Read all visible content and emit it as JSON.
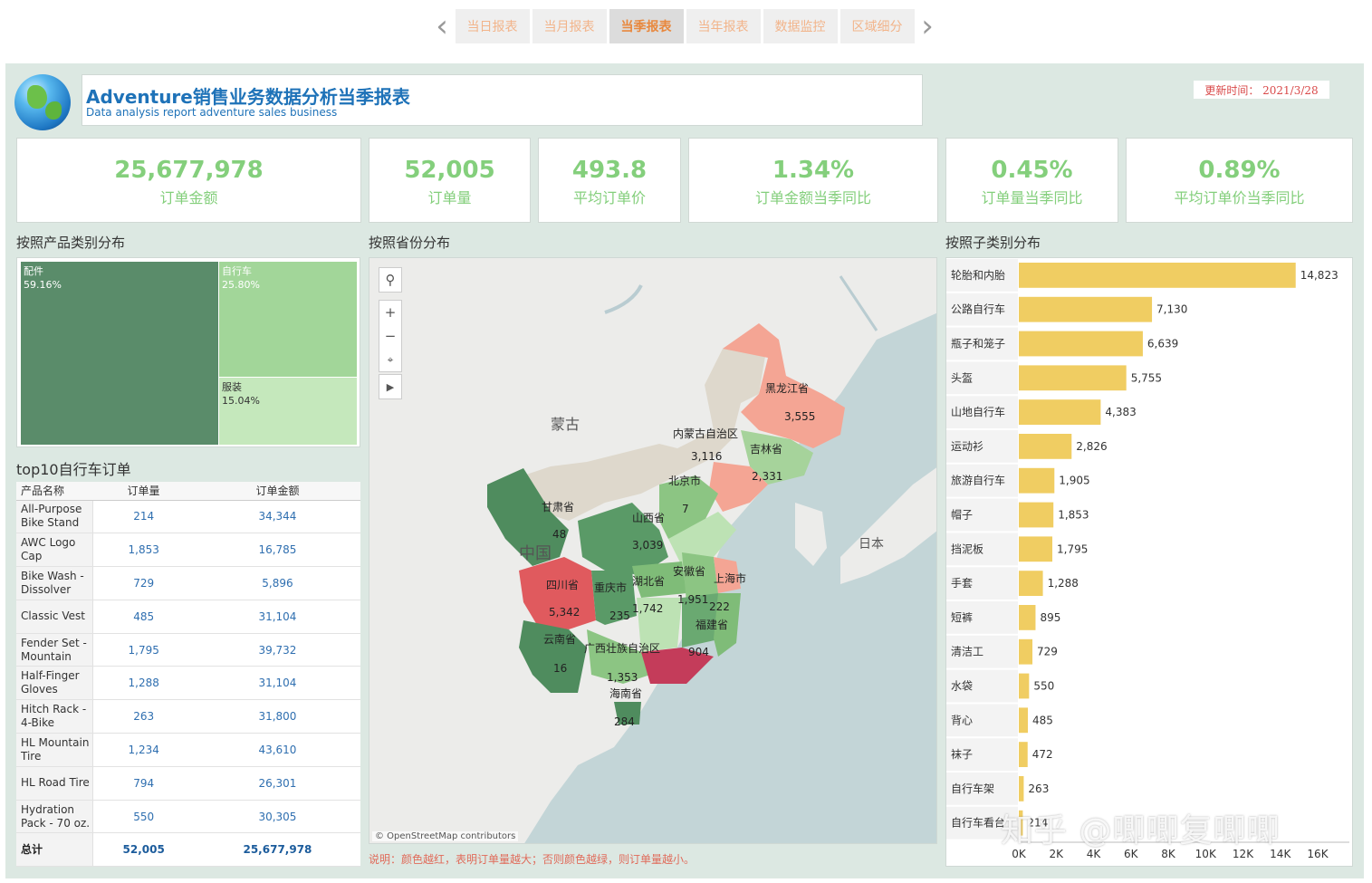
{
  "tabs": [
    {
      "label": "当日报表",
      "active": false
    },
    {
      "label": "当月报表",
      "active": false
    },
    {
      "label": "当季报表",
      "active": true
    },
    {
      "label": "当年报表",
      "active": false
    },
    {
      "label": "数据监控",
      "active": false
    },
    {
      "label": "区域细分",
      "active": false
    }
  ],
  "header": {
    "title": "Adventure销售业务数据分析当季报表",
    "subtitle": "Data analysis report adventure sales business",
    "update_time": "更新时间： 2021/3/28"
  },
  "kpis": [
    {
      "value": "25,677,978",
      "label": "订单金额"
    },
    {
      "value": "52,005",
      "label": "订单量"
    },
    {
      "value": "493.8",
      "label": "平均订单价"
    },
    {
      "value": "1.34%",
      "label": "订单金额当季同比"
    },
    {
      "value": "0.45%",
      "label": "订单量当季同比"
    },
    {
      "value": "0.89%",
      "label": "平均订单价当季同比"
    }
  ],
  "sections": {
    "category": "按照产品类别分布",
    "province": "按照省份分布",
    "subcategory": "按照子类别分布",
    "top10": "top10自行车订单"
  },
  "treemap": [
    {
      "name": "配件",
      "pct": "59.16%",
      "value": 59.16
    },
    {
      "name": "自行车",
      "pct": "25.80%",
      "value": 25.8
    },
    {
      "name": "服装",
      "pct": "15.04%",
      "value": 15.04
    }
  ],
  "table": {
    "headers": [
      "产品名称",
      "订单量",
      "订单金额"
    ],
    "rows": [
      [
        "All-Purpose Bike Stand",
        "214",
        "34,344"
      ],
      [
        "AWC Logo Cap",
        "1,853",
        "16,785"
      ],
      [
        "Bike Wash - Dissolver",
        "729",
        "5,896"
      ],
      [
        "Classic Vest",
        "485",
        "31,104"
      ],
      [
        "Fender Set - Mountain",
        "1,795",
        "39,732"
      ],
      [
        "Half-Finger Gloves",
        "1,288",
        "31,104"
      ],
      [
        "Hitch Rack - 4-Bike",
        "263",
        "31,800"
      ],
      [
        "HL Mountain Tire",
        "1,234",
        "43,610"
      ],
      [
        "HL Road Tire",
        "794",
        "26,301"
      ],
      [
        "Hydration Pack - 70 oz.",
        "550",
        "30,305"
      ]
    ],
    "total": [
      "总计",
      "52,005",
      "25,677,978"
    ]
  },
  "map": {
    "country_labels": [
      "蒙古",
      "中国",
      "日本"
    ],
    "provinces": [
      {
        "name": "黑龙江省",
        "value": "3,555"
      },
      {
        "name": "内蒙古自治区",
        "value": "3,116"
      },
      {
        "name": "吉林省",
        "value": "2,331"
      },
      {
        "name": "北京市",
        "value": "7"
      },
      {
        "name": "甘肃省",
        "value": "48"
      },
      {
        "name": "山西省",
        "value": "3,039"
      },
      {
        "name": "四川省",
        "value": "5,342"
      },
      {
        "name": "重庆市",
        "value": "235"
      },
      {
        "name": "湖北省",
        "value": "1,742"
      },
      {
        "name": "安徽省",
        "value": "1,951"
      },
      {
        "name": "上海市",
        "value": "222"
      },
      {
        "name": "云南省",
        "value": "16"
      },
      {
        "name": "广西壮族自治区",
        "value": "1,353"
      },
      {
        "name": "福建省",
        "value": "904"
      },
      {
        "name": "海南省",
        "value": "284"
      }
    ],
    "attribution": "© OpenStreetMap contributors",
    "controls": [
      "search-icon",
      "plus-icon",
      "minus-icon",
      "lasso-icon",
      "play-icon"
    ]
  },
  "note": "说明：颜色越红，表明订单量越大；否则颜色越绿，则订单量越小。",
  "chart_data": {
    "type": "bar",
    "orientation": "horizontal",
    "categories": [
      "轮胎和内胎",
      "公路自行车",
      "瓶子和笼子",
      "头盔",
      "山地自行车",
      "运动衫",
      "旅游自行车",
      "帽子",
      "挡泥板",
      "手套",
      "短裤",
      "清洁工",
      "水袋",
      "背心",
      "袜子",
      "自行车架",
      "自行车看台"
    ],
    "values": [
      14823,
      7130,
      6639,
      5755,
      4383,
      2826,
      1905,
      1853,
      1795,
      1288,
      895,
      729,
      550,
      485,
      472,
      263,
      214
    ],
    "value_labels": [
      "14,823",
      "7,130",
      "6,639",
      "5,755",
      "4,383",
      "2,826",
      "1,905",
      "1,853",
      "1,795",
      "1,288",
      "895",
      "729",
      "550",
      "485",
      "472",
      "263",
      "214"
    ],
    "xlim": [
      0,
      16000
    ],
    "xticks": [
      "0K",
      "2K",
      "4K",
      "6K",
      "8K",
      "10K",
      "12K",
      "14K",
      "16K"
    ],
    "color": "#f0cd62"
  },
  "watermark": "知乎 @唧唧复唧唧"
}
